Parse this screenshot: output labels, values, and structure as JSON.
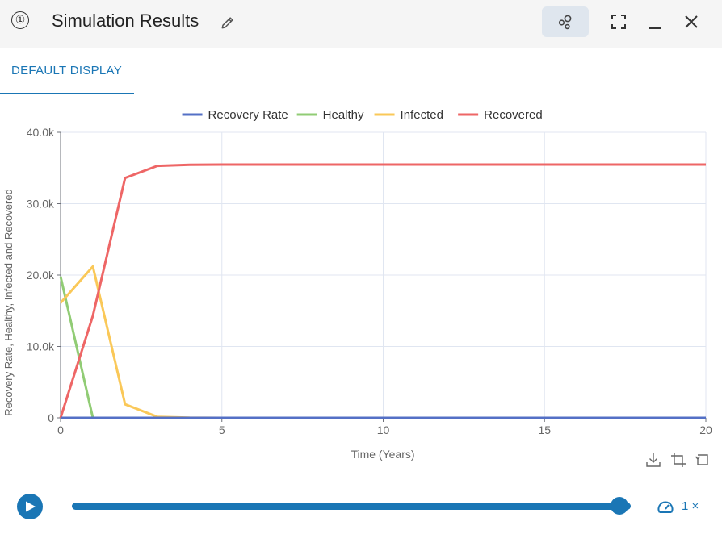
{
  "header": {
    "badge": "①",
    "title": "Simulation Results",
    "icons": [
      "edit-icon",
      "network-icon",
      "fullscreen-icon",
      "minimize-icon",
      "close-icon"
    ]
  },
  "tabs": [
    {
      "label": "DEFAULT DISPLAY",
      "active": true
    }
  ],
  "chart_data": {
    "type": "line",
    "xlabel": "Time (Years)",
    "ylabel": "Recovery Rate, Healthy, Infected and Recovered",
    "xlim": [
      0,
      20
    ],
    "ylim": [
      0,
      40000
    ],
    "xticks": [
      "0",
      "5",
      "10",
      "15",
      "20"
    ],
    "yticks": [
      "0",
      "10.0k",
      "20.0k",
      "30.0k",
      "40.0k"
    ],
    "grid": true,
    "legend_position": "top",
    "series": [
      {
        "name": "Recovery Rate",
        "color": "#5470c6",
        "points": [
          [
            0,
            0
          ],
          [
            1,
            0
          ],
          [
            2,
            0
          ],
          [
            3,
            0
          ],
          [
            4,
            0
          ],
          [
            5,
            0
          ],
          [
            10,
            0
          ],
          [
            15,
            0
          ],
          [
            20,
            0
          ]
        ]
      },
      {
        "name": "Healthy",
        "color": "#91cc75",
        "points": [
          [
            0,
            19800
          ],
          [
            1,
            0
          ],
          [
            2,
            0
          ],
          [
            3,
            0
          ],
          [
            4,
            0
          ],
          [
            5,
            0
          ],
          [
            10,
            0
          ],
          [
            15,
            0
          ],
          [
            20,
            0
          ]
        ]
      },
      {
        "name": "Infected",
        "color": "#fac858",
        "points": [
          [
            0,
            16100
          ],
          [
            1,
            21200
          ],
          [
            2,
            1900
          ],
          [
            3,
            150
          ],
          [
            4,
            20
          ],
          [
            5,
            0
          ],
          [
            10,
            0
          ],
          [
            15,
            0
          ],
          [
            20,
            0
          ]
        ]
      },
      {
        "name": "Recovered",
        "color": "#ee6666",
        "points": [
          [
            0,
            0
          ],
          [
            1,
            14300
          ],
          [
            2,
            33600
          ],
          [
            3,
            35300
          ],
          [
            4,
            35450
          ],
          [
            5,
            35480
          ],
          [
            10,
            35480
          ],
          [
            15,
            35480
          ],
          [
            20,
            35480
          ]
        ]
      }
    ]
  },
  "toolbox": [
    "download-icon",
    "crop-icon",
    "reset-icon"
  ],
  "player": {
    "progress": 1.0,
    "speed_label": "1 ×",
    "accent": "#1a76b5"
  }
}
